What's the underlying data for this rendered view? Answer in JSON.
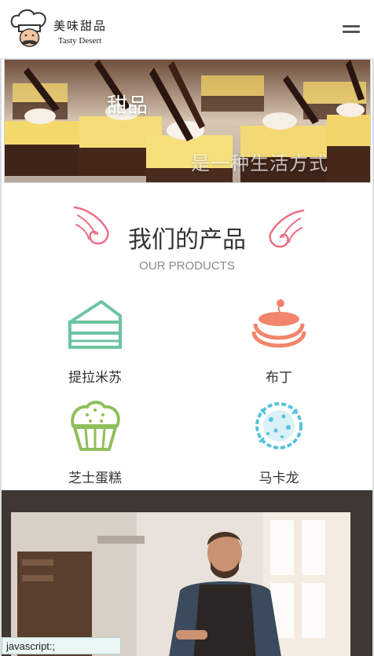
{
  "header": {
    "brand_cn": "美味甜品",
    "brand_en": "Tasty Desert"
  },
  "hero": {
    "title": "甜品",
    "subtitle": "是一种生活方式"
  },
  "products": {
    "title": "我们的产品",
    "subtitle": "OUR PRODUCTS",
    "items": [
      {
        "label": "提拉米苏",
        "icon": "cake-slice-icon",
        "color": "#6cc4a0"
      },
      {
        "label": "布丁",
        "icon": "pudding-icon",
        "color": "#f2856b"
      },
      {
        "label": "芝士蛋糕",
        "icon": "cupcake-icon",
        "color": "#8fbf5a"
      },
      {
        "label": "马卡龙",
        "icon": "macaron-icon",
        "color": "#55c3dd"
      }
    ]
  },
  "status_bar": {
    "text": "javascript:;"
  },
  "colors": {
    "wing": "#ec6f86",
    "accent": "#f2856b"
  }
}
